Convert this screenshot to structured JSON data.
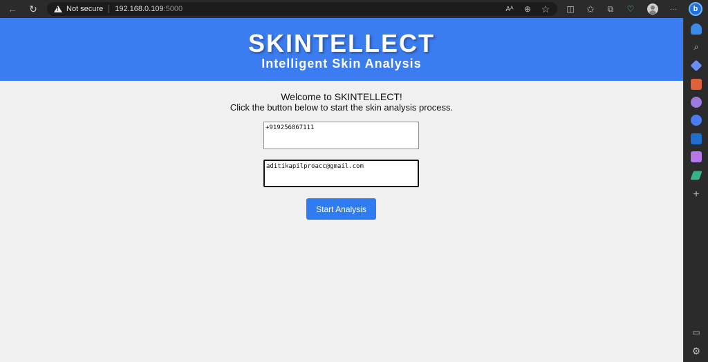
{
  "browser": {
    "security_label": "Not secure",
    "url_host": "192.168.0.109",
    "url_port": ":5000",
    "icons": [
      "back-icon",
      "refresh-icon",
      "warning-icon",
      "read-aloud-icon",
      "zoom-icon",
      "favorite-star-icon",
      "split-screen-icon",
      "favorites-icon",
      "collections-icon",
      "browser-essentials-icon",
      "profile-avatar-icon",
      "more-options-icon",
      "bing-copilot-icon"
    ]
  },
  "glyphs": {
    "back": "←",
    "refresh": "↻",
    "read_aloud": "Aᴬ",
    "zoom": "⊕",
    "star": "☆",
    "split": "◫",
    "favorites": "✩",
    "collections": "⧉",
    "essentials": "♡",
    "more": "···",
    "bing": "b",
    "search": "⌕",
    "add": "+",
    "panel": "▭",
    "settings": "⚙"
  },
  "page": {
    "title": "SKINTELLECT",
    "subtitle": "Intelligent Skin Analysis",
    "welcome": "Welcome to SKINTELLECT!",
    "instructions": "Click the button below to start the skin analysis process.",
    "phone_value": "+919256867111",
    "email_value": "aditikapilproacc@gmail.com",
    "start_button": "Start Analysis"
  },
  "colors": {
    "header_blue": "#3b7cf0",
    "button_blue": "#2f7cf2",
    "page_background": "#f0f0f0"
  },
  "sidebar": {
    "icons": [
      "notification-bell-icon",
      "search-icon",
      "shopping-tag-icon",
      "tools-briefcase-icon",
      "people-icon",
      "copilot-icon",
      "outlook-icon",
      "drop-editor-icon",
      "telescope-icon",
      "add-icon",
      "sidebar-toggle-icon",
      "settings-gear-icon"
    ]
  }
}
